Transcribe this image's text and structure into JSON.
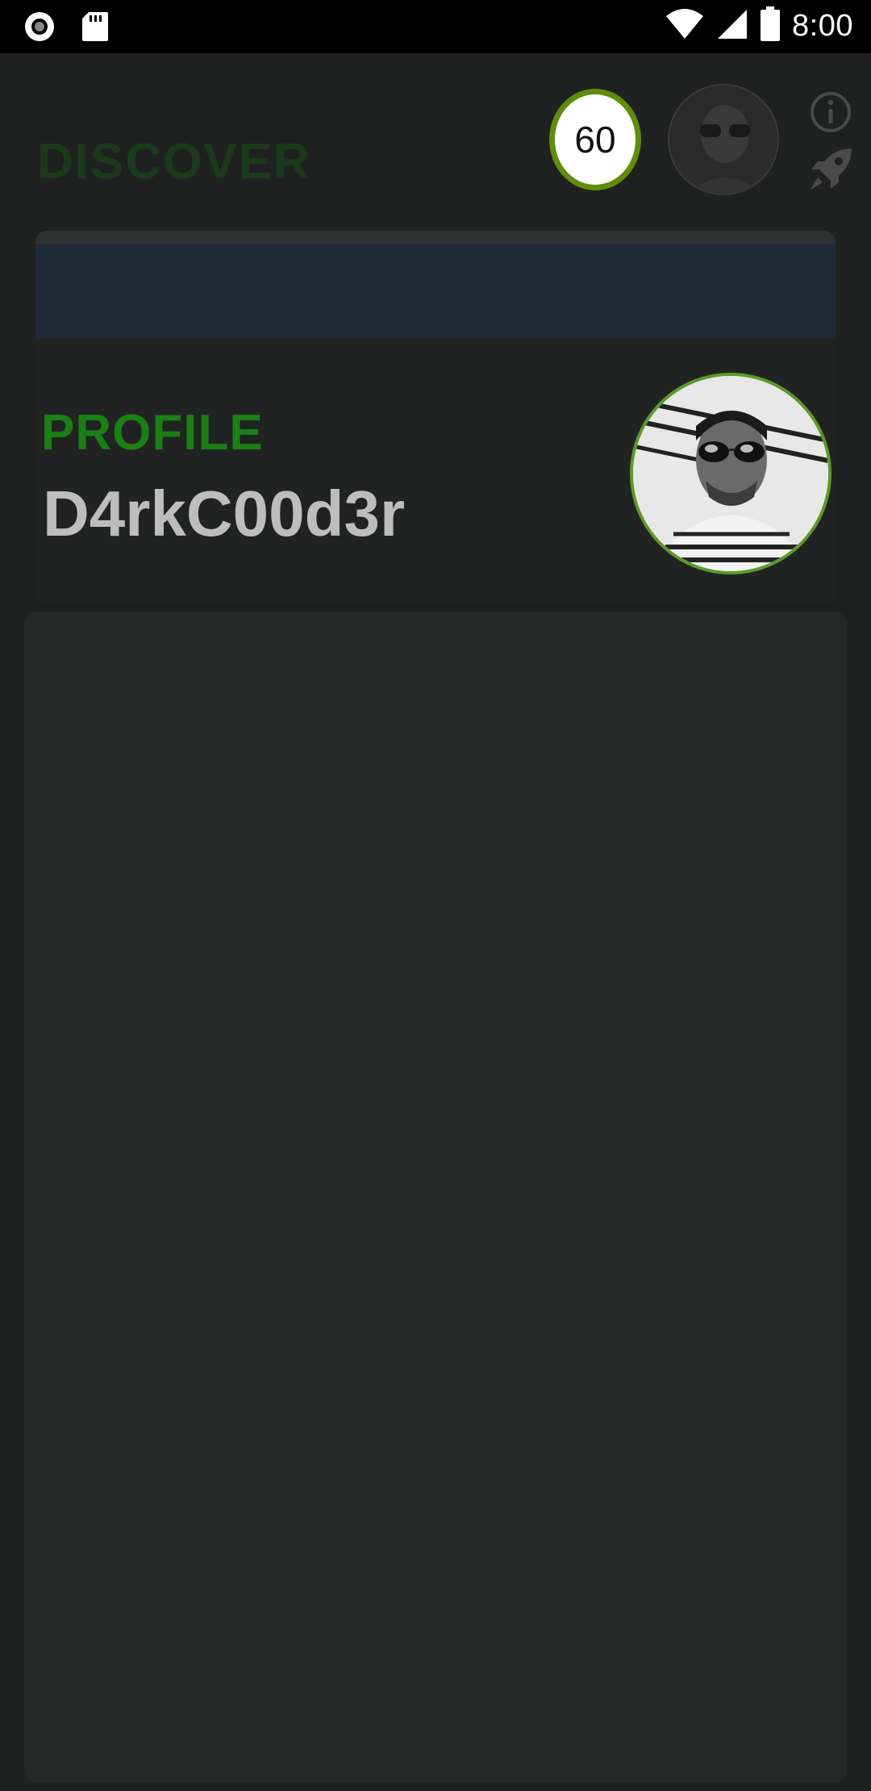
{
  "status_bar": {
    "time": "8:00",
    "icons": [
      "record-icon",
      "sd-card-icon",
      "wifi-icon",
      "cellular-icon",
      "battery-icon"
    ]
  },
  "header": {
    "title": "DISCOVER",
    "points": "60",
    "icons": [
      "info-icon",
      "rocket-icon"
    ]
  },
  "profile": {
    "label": "PROFILE",
    "username": "D4rkC00d3r"
  },
  "colors": {
    "accent_green": "#1a7f14",
    "badge_ring": "#5e8e0c",
    "avatar_ring": "#5a9a2a"
  }
}
